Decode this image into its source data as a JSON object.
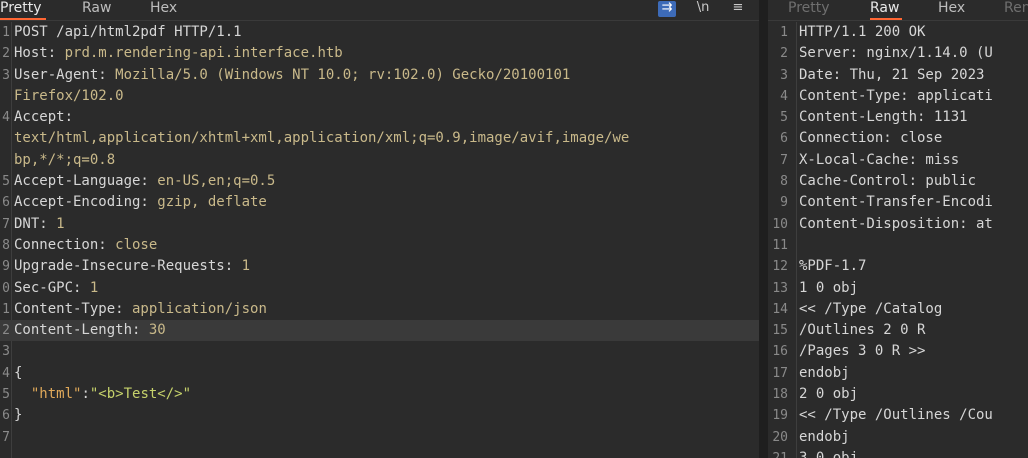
{
  "left": {
    "tabs": [
      {
        "label": "Pretty",
        "active": true
      },
      {
        "label": "Raw",
        "active": false
      },
      {
        "label": "Hex",
        "active": false
      }
    ],
    "tools": {
      "wrap": "⇉",
      "newline": "\\n",
      "menu": "≡"
    },
    "lines": [
      {
        "n": "1",
        "k": "POST /api/html2pdf HTTP/1.1",
        "v": ""
      },
      {
        "n": "2",
        "k": "Host:",
        "v": " prd.m.rendering-api.interface.htb"
      },
      {
        "n": "3",
        "k": "User-Agent:",
        "v": " Mozilla/5.0 (Windows NT 10.0; rv:102.0) Gecko/20100101"
      },
      {
        "n": "",
        "k": "",
        "v": "Firefox/102.0"
      },
      {
        "n": "4",
        "k": "Accept:",
        "v": ""
      },
      {
        "n": "",
        "k": "",
        "v": "text/html,application/xhtml+xml,application/xml;q=0.9,image/avif,image/we"
      },
      {
        "n": "",
        "k": "",
        "v": "bp,*/*;q=0.8"
      },
      {
        "n": "5",
        "k": "Accept-Language:",
        "v": " en-US,en;q=0.5"
      },
      {
        "n": "6",
        "k": "Accept-Encoding:",
        "v": " gzip, deflate"
      },
      {
        "n": "7",
        "k": "DNT:",
        "v": " 1"
      },
      {
        "n": "8",
        "k": "Connection:",
        "v": " close"
      },
      {
        "n": "9",
        "k": "Upgrade-Insecure-Requests:",
        "v": " 1"
      },
      {
        "n": "0",
        "k": "Sec-GPC:",
        "v": " 1"
      },
      {
        "n": "1",
        "k": "Content-Type:",
        "v": " application/json"
      },
      {
        "n": "2",
        "k": "Content-Length:",
        "v": " 30"
      },
      {
        "n": "3",
        "k": "",
        "v": ""
      },
      {
        "n": "4",
        "k": "{",
        "v": ""
      },
      {
        "n": "5",
        "k": "",
        "v": ""
      },
      {
        "n": "6",
        "k": "}",
        "v": ""
      },
      {
        "n": "7",
        "k": "",
        "v": ""
      }
    ],
    "json_line": {
      "indent": "  ",
      "key": "\"html\"",
      "colon": ":",
      "value": "\"<b>Test</>\""
    }
  },
  "right": {
    "tabs": [
      {
        "label": "Pretty",
        "active": false
      },
      {
        "label": "Raw",
        "active": true
      },
      {
        "label": "Hex",
        "active": false
      },
      {
        "label": "Ren",
        "active": false
      }
    ],
    "lines": [
      {
        "n": "1",
        "t": "HTTP/1.1 200 OK"
      },
      {
        "n": "2",
        "t": "Server: nginx/1.14.0 (U"
      },
      {
        "n": "3",
        "t": "Date: Thu, 21 Sep 2023"
      },
      {
        "n": "4",
        "t": "Content-Type: applicati"
      },
      {
        "n": "5",
        "t": "Content-Length: 1131"
      },
      {
        "n": "6",
        "t": "Connection: close"
      },
      {
        "n": "7",
        "t": "X-Local-Cache: miss"
      },
      {
        "n": "8",
        "t": "Cache-Control: public"
      },
      {
        "n": "9",
        "t": "Content-Transfer-Encodi"
      },
      {
        "n": "10",
        "t": "Content-Disposition: at"
      },
      {
        "n": "11",
        "t": ""
      },
      {
        "n": "12",
        "t": "%PDF-1.7"
      },
      {
        "n": "13",
        "t": "1 0 obj"
      },
      {
        "n": "14",
        "t": "<< /Type /Catalog"
      },
      {
        "n": "15",
        "t": "/Outlines 2 0 R"
      },
      {
        "n": "16",
        "t": "/Pages 3 0 R >>"
      },
      {
        "n": "17",
        "t": "endobj"
      },
      {
        "n": "18",
        "t": "2 0 obj"
      },
      {
        "n": "19",
        "t": "<< /Type /Outlines /Cou"
      },
      {
        "n": "20",
        "t": "endobj"
      },
      {
        "n": "21",
        "t": "3 0 obj"
      }
    ]
  }
}
